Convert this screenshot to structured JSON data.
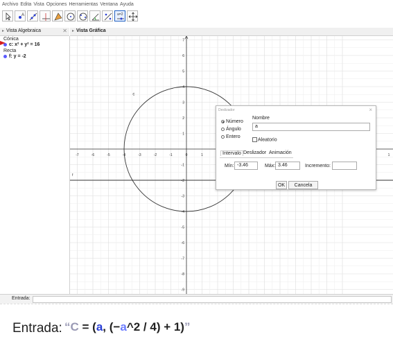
{
  "menu": [
    "Archivo",
    "Edita",
    "Vista",
    "Opciones",
    "Herramientas",
    "Ventana",
    "Ayuda"
  ],
  "tools": [
    "move-tool-icon",
    "point-tool-icon",
    "line-tool-icon",
    "perpendicular-tool-icon",
    "polygon-tool-icon",
    "circle-tool-icon",
    "conic-tool-icon",
    "angle-tool-icon",
    "reflect-tool-icon",
    "slider-tool-icon",
    "move-view-tool-icon"
  ],
  "algebra": {
    "header": "Vista Algebraica",
    "conic_label": "Cónica",
    "conic_item": "c: x² + y² = 16",
    "line_label": "Recta",
    "line_item": "f: y = -2"
  },
  "graphics": {
    "header": "Vista Gráfica",
    "circle_label": "c",
    "line_label": "f",
    "x_ticks": [
      "-7",
      "-6",
      "-5",
      "-4",
      "-3",
      "-2",
      "-1",
      "0",
      "1",
      "2",
      "1"
    ],
    "y_ticks": [
      "7",
      "6",
      "5",
      "4",
      "3",
      "2",
      "1",
      "-1",
      "-2",
      "-3",
      "-4",
      "-5",
      "-6",
      "-7",
      "-8",
      "-9"
    ],
    "xlim": [
      -7.5,
      11
    ],
    "ylim": [
      -9.5,
      8.5
    ],
    "circle_radius": 4,
    "line_y": -2,
    "accent_color": "#d42020"
  },
  "dialog": {
    "title": "Deslizador",
    "close": "×",
    "radio_numero": "Número",
    "radio_angulo": "Ángulo",
    "radio_entero": "Entero",
    "name_label": "Nombre",
    "name_value": "a",
    "random_label": "Aleatorio",
    "tab_interval": "Intervalo",
    "tab_slider": "Deslizador",
    "tab_animation": "Animación",
    "min_label": "Mín:",
    "min_value": "-3.46",
    "max_label": "Máx:",
    "max_value": "3.46",
    "inc_label": "Incremento:",
    "inc_value": "",
    "ok": "OK",
    "cancel": "Cancela"
  },
  "input_bar": {
    "label": "Entrada:"
  },
  "zoomed_input": {
    "label": "Entrada:",
    "open_quote": "“",
    "c": "C",
    "eq_open": " = (",
    "a1": "a",
    "mid": ", (−",
    "a2": "a",
    "rest": "^2 / 4) + 1)",
    "close_quote": "”"
  }
}
